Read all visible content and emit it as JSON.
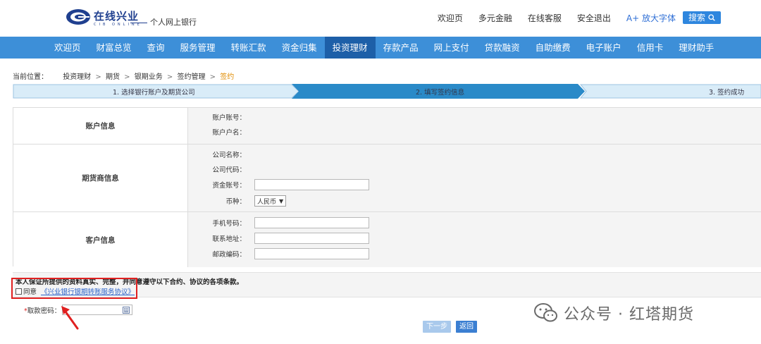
{
  "header": {
    "brand": "在线兴业",
    "brand_sub": "CIB ONLINE",
    "tagline": "个人网上银行",
    "links": [
      "欢迎页",
      "多元金融",
      "在线客服",
      "安全退出"
    ],
    "font_toggle": "A+ 放大字体",
    "search_label": "搜索"
  },
  "nav": {
    "items": [
      "欢迎页",
      "财富总览",
      "查询",
      "服务管理",
      "转账汇款",
      "资金归集",
      "投资理财",
      "存款产品",
      "网上支付",
      "贷款融资",
      "自助缴费",
      "电子账户",
      "信用卡",
      "理财助手"
    ],
    "active": "投资理财"
  },
  "breadcrumb": {
    "label": "当前位置：",
    "items": [
      "投资理财",
      "期货",
      "银期业务",
      "签约管理"
    ],
    "current": "签约"
  },
  "steps": [
    {
      "label": "1.   选择银行账户及期货公司"
    },
    {
      "label": "2.   填写签约信息"
    },
    {
      "label": "3.   签约成功"
    }
  ],
  "form": {
    "account": {
      "title": "账户信息",
      "fields": [
        {
          "label": "账户账号："
        },
        {
          "label": "账户户名："
        }
      ]
    },
    "futures": {
      "title": "期货商信息",
      "fields": [
        {
          "label": "公司名称："
        },
        {
          "label": "公司代码："
        },
        {
          "label": "资金账号：",
          "value": ""
        }
      ],
      "currency_label": "币种：",
      "currency_value": "人民币"
    },
    "customer": {
      "title": "客户信息",
      "fields": [
        {
          "label": "手机号码：",
          "value": ""
        },
        {
          "label": "联系地址：",
          "value": ""
        },
        {
          "label": "邮政编码：",
          "value": ""
        }
      ]
    }
  },
  "agreement": {
    "statement": "本人保证所提供的资料真实、完整，并同意遵守以下合约、协议的各项条款。",
    "agree_label": "同意",
    "link_text": "《兴业银行银期转账服务协议》",
    "checked": false
  },
  "password": {
    "label": "取款密码：",
    "required_mark": "*"
  },
  "buttons": {
    "next": "下一步",
    "back": "返回"
  },
  "watermark": {
    "text": "公众号 · 红塔期货"
  },
  "colors": {
    "nav_bg": "#3d8fd8",
    "nav_active": "#1d5fa8",
    "brand": "#1f3f8f",
    "step_active": "#2a8ac8",
    "annotation_red": "#e02020"
  }
}
